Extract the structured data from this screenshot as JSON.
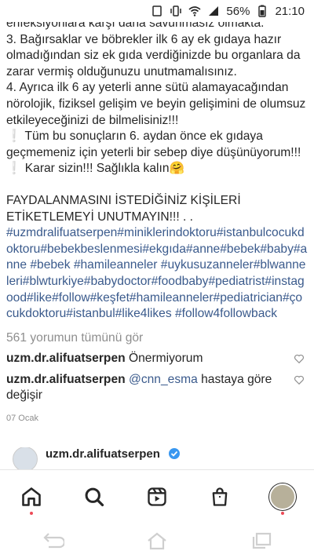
{
  "status_bar": {
    "battery": "56%",
    "time": "21:10"
  },
  "caption": {
    "lines": [
      "enfeksiyonlara karşı daha savunmasız olmakta.",
      "3. Bağırsaklar ve böbrekler ilk 6 ay ek gıdaya hazır olmadığından siz ek gıda verdiğinizde bu organlara da zarar vermiş olduğunuzu unutmamalısınız.",
      "4. Ayrıca ilk 6 ay yeterli anne sütü alamayacağından nörolojik, fiziksel gelişim ve beyin gelişimini de olumsuz etkileyeceğinizi de bilmelisiniz!!!",
      "❕ Tüm bu sonuçların 6. aydan önce ek gıdaya geçmemeniz için yeterli bir sebep diye düşünüyorum!!! ❕ Karar sizin!!! Sağlıkla kalın🤗",
      "FAYDALANMASINI İSTEDİĞİNİZ KİŞİLERİ ETİKETLEMEYİ UNUTMAYIN!!! . ."
    ],
    "hashtags": "#uzmdralifuatserpen#miniklerindoktoru#istanbulcocukdoktoru#bebekbeslenmesi#ekgıda#anne#bebek#baby#anne #bebek #hamileanneler #uykusuzanneler#blwanneleri#blwturkiye#babydoctor#foodbaby#pediatrist#instagood#like#follow#keşfet#hamileanneler#pediatrician#çocukdoktoru#istanbul#like4likes #follow4followback"
  },
  "comments_link": "561 yorumun tümünü gör",
  "comments": [
    {
      "user": "uzm.dr.alifuatserpen",
      "mention": "",
      "text": "Önermiyorum"
    },
    {
      "user": "uzm.dr.alifuatserpen",
      "mention": "@cnn_esma",
      "text": "hastaya göre değişir"
    }
  ],
  "post_date": "07 Ocak",
  "next_post": {
    "author": "uzm.dr.alifuatserpen"
  },
  "nav": {
    "items": [
      "home-icon",
      "search-icon",
      "reels-icon",
      "shop-icon",
      "profile-avatar"
    ]
  },
  "colors": {
    "link": "#3a5a8c",
    "muted": "#8e8e8e",
    "text": "#262626",
    "notification": "#ed4956",
    "verified": "#3897f0"
  }
}
